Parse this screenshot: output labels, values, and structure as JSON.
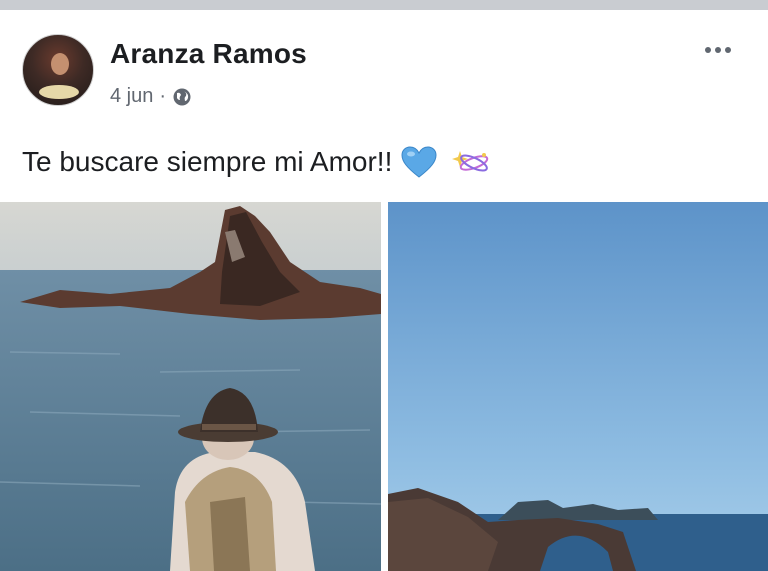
{
  "post": {
    "author": "Aranza Ramos",
    "date": "4 jun",
    "separator": "·",
    "privacy_icon": "globe-icon",
    "more_icon": "more-options-icon",
    "text": "Te buscare siempre mi Amor!!",
    "emojis": [
      "blue-heart-icon",
      "sparkle-icon"
    ]
  },
  "photos": [
    {
      "subject": "person-in-hat-by-sea"
    },
    {
      "subject": "blue-sky-rock-arch"
    }
  ],
  "colors": {
    "author_text": "#1c1e21",
    "meta_text": "#616770",
    "heart": "#5aa8e6"
  }
}
